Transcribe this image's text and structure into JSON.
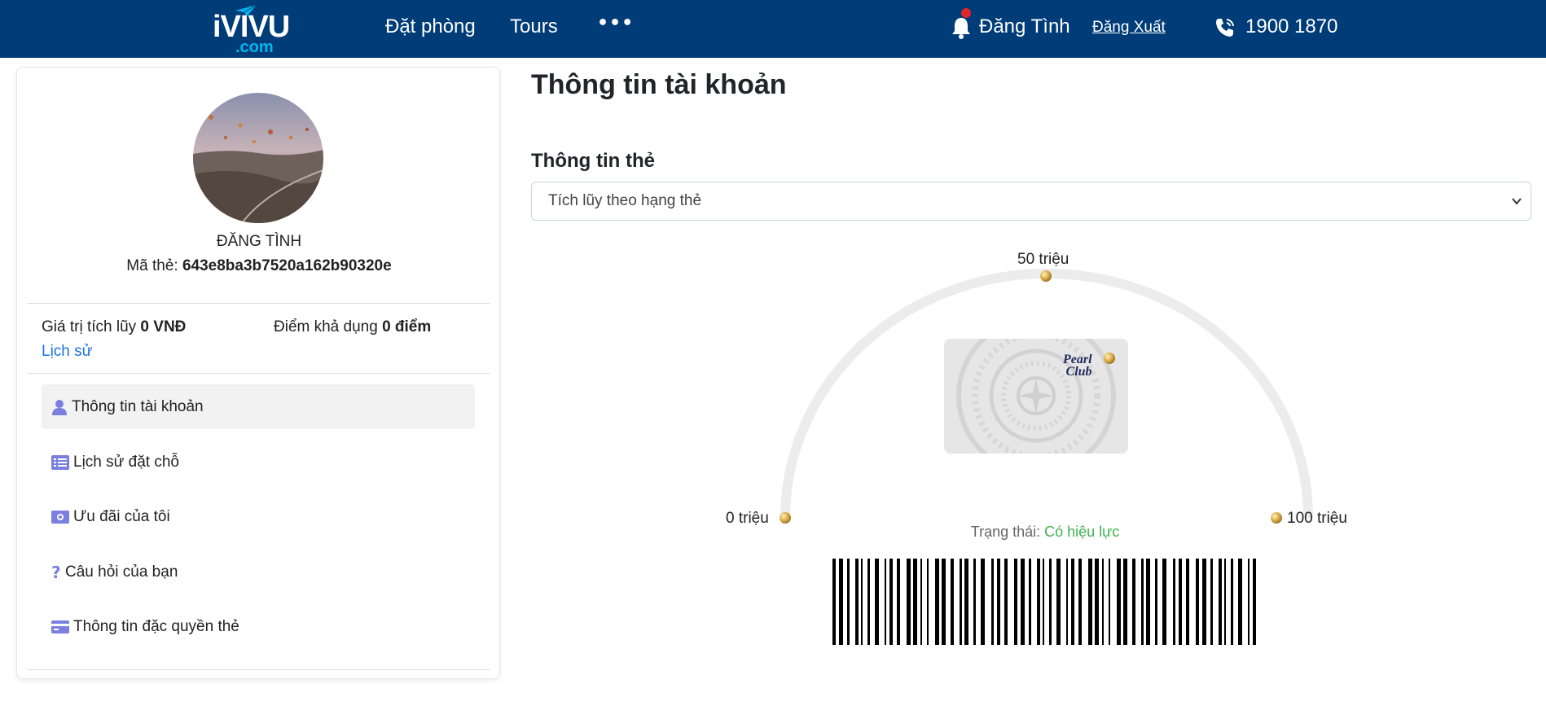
{
  "header": {
    "logo_brand": "iVIVU",
    "logo_domain": ".com",
    "nav": [
      "Đặt phòng",
      "Tours"
    ],
    "more": "•••",
    "user_name": "Đăng Tình",
    "logout": "Đăng Xuất",
    "hotline": "1900 1870",
    "bg_color": "#003c78"
  },
  "sidebar": {
    "profile_name": "ĐĂNG TÌNH",
    "card_code_label": "Mã thẻ: ",
    "card_code_value": "643e8ba3b7520a162b90320e",
    "accumulated_label": "Giá trị tích lũy ",
    "accumulated_value": "0 VNĐ",
    "points_label": "Điểm khả dụng ",
    "points_value": "0 điểm",
    "history_link": "Lịch sử",
    "menu": [
      {
        "label": "Thông tin tài khoản",
        "icon": "user-icon",
        "active": true
      },
      {
        "label": "Lịch sử đặt chỗ",
        "icon": "list-icon"
      },
      {
        "label": "Ưu đãi của tôi",
        "icon": "money-icon"
      },
      {
        "label": "Câu hỏi của bạn",
        "icon": "question-icon"
      },
      {
        "label": "Thông tin đặc quyền thẻ",
        "icon": "credit-card-icon"
      }
    ]
  },
  "main": {
    "page_title": "Thông tin tài khoản",
    "section_title": "Thông tin thẻ",
    "select_value": "Tích lũy theo hạng thẻ",
    "gauge": {
      "label_min": "0 triệu",
      "label_mid": "50 triệu",
      "label_max": "100 triệu",
      "progress": 0
    },
    "card_brand_line1": "Pearl",
    "card_brand_line2": "Club",
    "status_label": "Trạng thái: ",
    "status_value": "Có hiệu lực",
    "status_color": "#3fb34f"
  }
}
